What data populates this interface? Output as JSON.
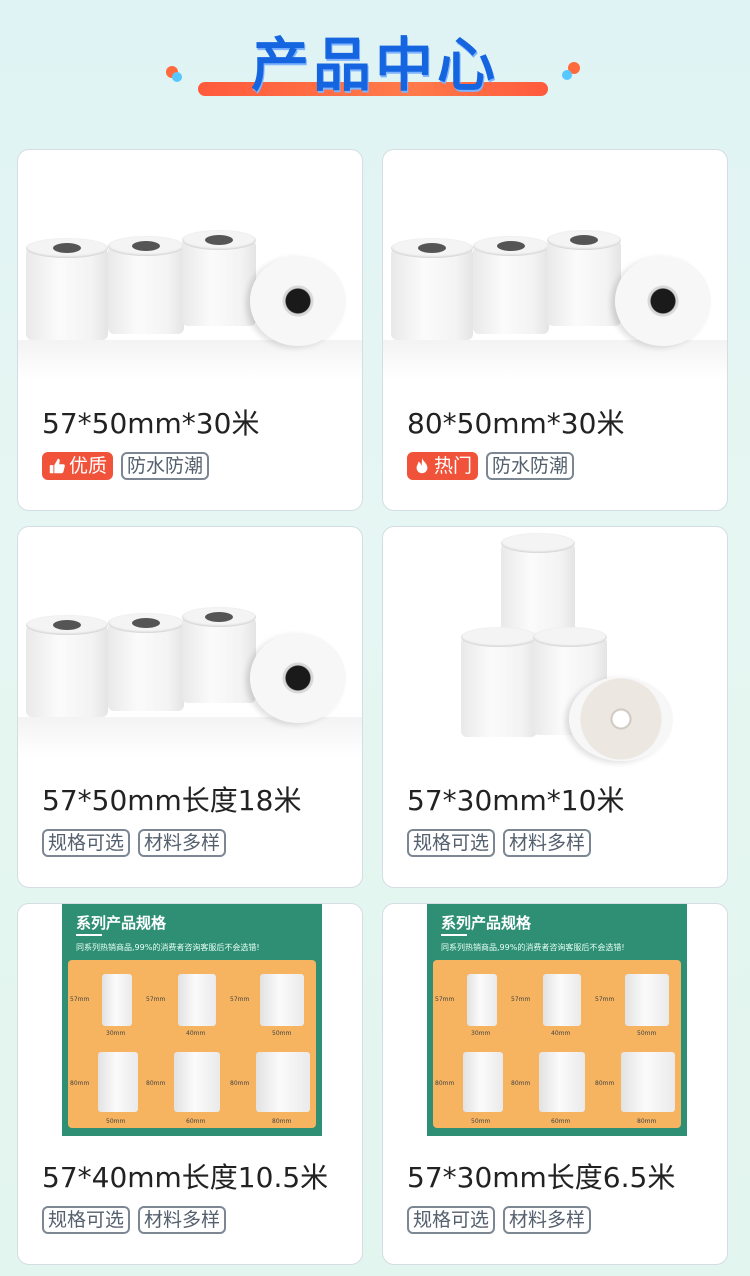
{
  "header": {
    "title": "产品中心"
  },
  "products": [
    {
      "name": "57*50mm*30米",
      "badge": "优质",
      "badge_icon": "thumbs-up-icon",
      "tags": [
        "防水防潮"
      ]
    },
    {
      "name": "80*50mm*30米",
      "badge": "热门",
      "badge_icon": "flame-icon",
      "tags": [
        "防水防潮"
      ]
    },
    {
      "name": "57*50mm长度18米",
      "tags": [
        "规格可选",
        "材料多样"
      ]
    },
    {
      "name": "57*30mm*10米",
      "tags": [
        "规格可选",
        "材料多样"
      ]
    },
    {
      "name": "57*40mm长度10.5米",
      "tags": [
        "规格可选",
        "材料多样"
      ]
    },
    {
      "name": "57*30mm长度6.5米",
      "tags": [
        "规格可选",
        "材料多样"
      ]
    }
  ],
  "poster": {
    "title": "系列产品规格",
    "subtitle": "同系列热销商品,99%的消费者咨询客服后不会选错!",
    "heights": [
      "57mm",
      "57mm",
      "57mm",
      "80mm",
      "80mm",
      "80mm"
    ],
    "widths": [
      "30mm",
      "40mm",
      "50mm",
      "50mm",
      "60mm",
      "80mm"
    ]
  },
  "colors": {
    "title": "#1565e0",
    "accent": "#f0533a",
    "poster_bg": "#2f8f74",
    "poster_panel": "#f6b360"
  }
}
